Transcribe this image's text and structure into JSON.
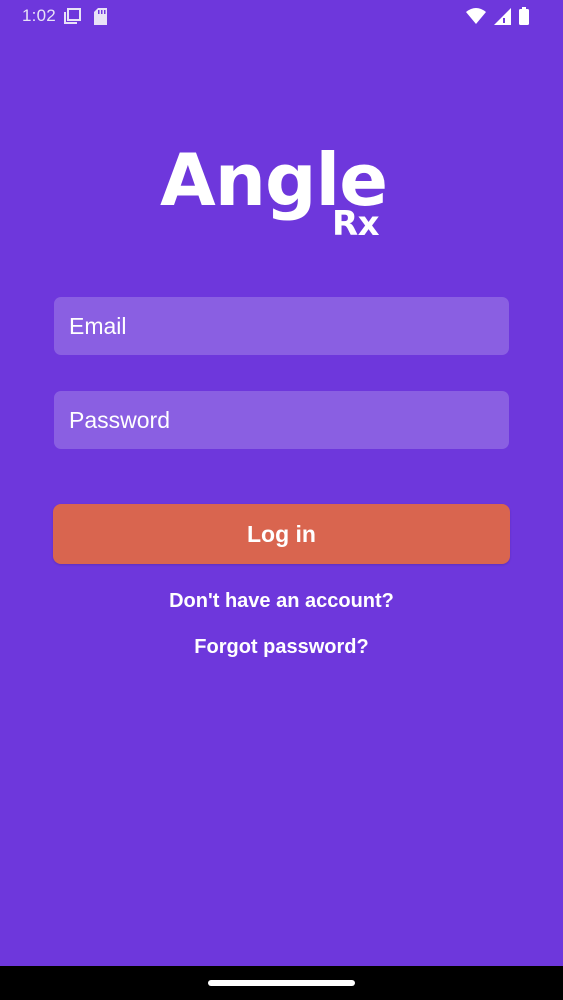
{
  "status_bar": {
    "time": "1:02",
    "left_icons": [
      "screen-icon",
      "sd-card-icon"
    ],
    "right_icons": [
      "wifi-icon",
      "cell-signal-icon",
      "battery-icon"
    ]
  },
  "logo": {
    "word": "Angle",
    "sub": "Rx"
  },
  "form": {
    "email_placeholder": "Email",
    "password_placeholder": "Password",
    "login_label": "Log in",
    "signup_link": "Don't have an account?",
    "forgot_link": "Forgot password?"
  },
  "colors": {
    "background": "#6e37dc",
    "input": "#8a5fe2",
    "button": "#d9654f",
    "text": "#ffffff"
  }
}
